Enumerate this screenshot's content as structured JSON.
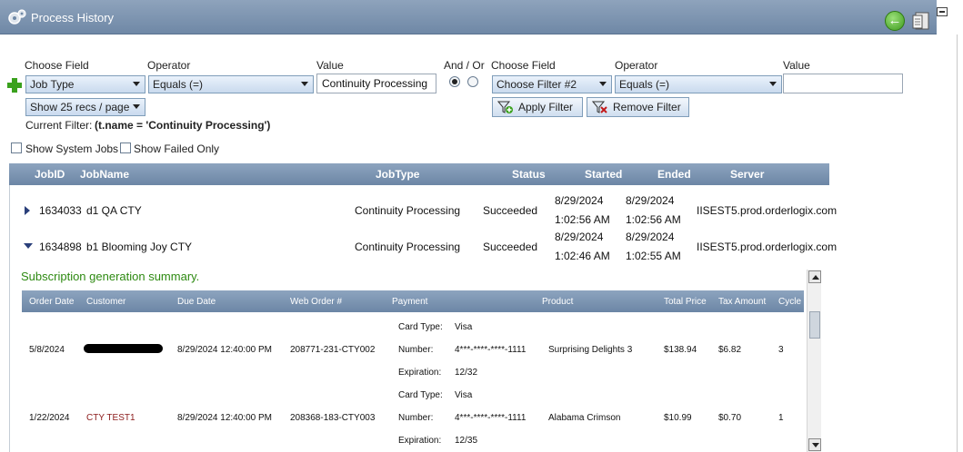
{
  "window": {
    "title": "Process History"
  },
  "filters": {
    "left": {
      "field_label": "Choose Field",
      "operator_label": "Operator",
      "value_label": "Value",
      "field_value": "Job Type",
      "operator_value": "Equals (=)",
      "value_text": "Continuity Processing"
    },
    "and_or_label": "And / Or",
    "right": {
      "field_label": "Choose Field",
      "operator_label": "Operator",
      "value_label": "Value",
      "field_value": "Choose Filter #2",
      "operator_value": "Equals (=)",
      "value_text": ""
    },
    "page_size": "Show 25 recs / page",
    "current_filter_label": "Current Filter:",
    "current_filter_value": "(t.name = 'Continuity Processing')",
    "apply_label": "Apply Filter",
    "remove_label": "Remove Filter",
    "show_system_jobs": "Show System Jobs",
    "show_failed_only": "Show Failed Only"
  },
  "grid": {
    "columns": [
      "JobID",
      "JobName",
      "JobType",
      "Status",
      "Started",
      "Ended",
      "Server"
    ],
    "rows": [
      {
        "id": "1634033",
        "name": "d1 QA CTY",
        "type": "Continuity Processing",
        "status": "Succeeded",
        "started_date": "8/29/2024",
        "started_time": "1:02:56 AM",
        "ended_date": "8/29/2024",
        "ended_time": "1:02:56 AM",
        "server": "IISEST5.prod.orderlogix.com"
      },
      {
        "id": "1634898",
        "name": "b1 Blooming Joy CTY",
        "type": "Continuity Processing",
        "status": "Succeeded",
        "started_date": "8/29/2024",
        "started_time": "1:02:46 AM",
        "ended_date": "8/29/2024",
        "ended_time": "1:02:55 AM",
        "server": "IISEST5.prod.orderlogix.com"
      }
    ]
  },
  "summary": {
    "title": "Subscription generation summary.",
    "columns": [
      "Order Date",
      "Customer",
      "Due Date",
      "Web Order #",
      "Payment",
      "Product",
      "Total Price",
      "Tax Amount",
      "Cycle"
    ],
    "payment_labels": {
      "card_type": "Card Type:",
      "number": "Number:",
      "expiration": "Expiration:"
    },
    "rows": [
      {
        "order_date": "5/8/2024",
        "customer": "",
        "due_date": "8/29/2024 12:40:00 PM",
        "web_order": "208771-231-CTY002",
        "card_type": "Visa",
        "number": "4***-****-****-1111",
        "expiration": "12/32",
        "product": "Surprising Delights 3",
        "total": "$138.94",
        "tax": "$6.82",
        "cycle": "3"
      },
      {
        "order_date": "1/22/2024",
        "customer": "CTY TEST1",
        "due_date": "8/29/2024 12:40:00 PM",
        "web_order": "208368-183-CTY003",
        "card_type": "Visa",
        "number": "4***-****-****-1111",
        "expiration": "12/35",
        "product": "Alabama Crimson",
        "total": "$10.99",
        "tax": "$0.70",
        "cycle": "1"
      }
    ]
  },
  "colors": {
    "header_blue": "#6f88a6",
    "summary_green": "#2e8a12",
    "customer_red": "#8b1a1a"
  }
}
